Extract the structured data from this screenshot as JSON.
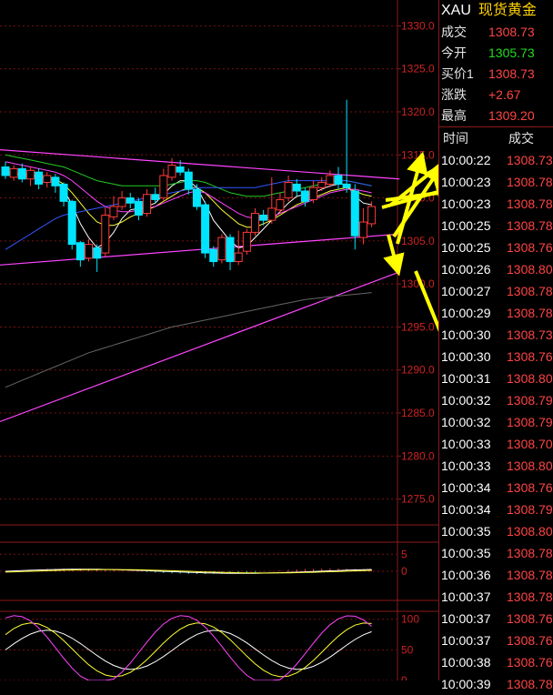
{
  "header": {
    "symbol": "XAU",
    "name": "现货黄金"
  },
  "quote": [
    {
      "label": "成交",
      "value": "1308.73",
      "color": "#ff4444"
    },
    {
      "label": "今开",
      "value": "1305.73",
      "color": "#22dd22"
    },
    {
      "label": "买价1",
      "value": "1308.73",
      "color": "#ff4444"
    },
    {
      "label": "涨跌",
      "value": "+2.67",
      "color": "#ff4444"
    },
    {
      "label": "最高",
      "value": "1309.20",
      "color": "#ff4444"
    }
  ],
  "ticks_header": {
    "time": "时间",
    "price": "成交"
  },
  "ticks": [
    {
      "time": "10:00:22",
      "price": "1308.73"
    },
    {
      "time": "10:00:23",
      "price": "1308.78"
    },
    {
      "time": "10:00:23",
      "price": "1308.78"
    },
    {
      "time": "10:00:25",
      "price": "1308.78"
    },
    {
      "time": "10:00:25",
      "price": "1308.76"
    },
    {
      "time": "10:00:26",
      "price": "1308.80"
    },
    {
      "time": "10:00:27",
      "price": "1308.78"
    },
    {
      "time": "10:00:29",
      "price": "1308.78"
    },
    {
      "time": "10:00:30",
      "price": "1308.73"
    },
    {
      "time": "10:00:30",
      "price": "1308.76"
    },
    {
      "time": "10:00:31",
      "price": "1308.80"
    },
    {
      "time": "10:00:32",
      "price": "1308.79"
    },
    {
      "time": "10:00:32",
      "price": "1308.79"
    },
    {
      "time": "10:00:33",
      "price": "1308.70"
    },
    {
      "time": "10:00:33",
      "price": "1308.80"
    },
    {
      "time": "10:00:34",
      "price": "1308.76"
    },
    {
      "time": "10:00:34",
      "price": "1308.79"
    },
    {
      "time": "10:00:35",
      "price": "1308.80"
    },
    {
      "time": "10:00:35",
      "price": "1308.78"
    },
    {
      "time": "10:00:36",
      "price": "1308.78"
    },
    {
      "time": "10:00:37",
      "price": "1308.78"
    },
    {
      "time": "10:00:37",
      "price": "1308.76"
    },
    {
      "time": "10:00:37",
      "price": "1308.76"
    },
    {
      "time": "10:00:38",
      "price": "1308.76"
    },
    {
      "time": "10:00:39",
      "price": "1308.78"
    }
  ],
  "chart_data": {
    "type": "candlestick",
    "y_ticks": [
      "1330.0",
      "1325.0",
      "1320.0",
      "1315.0",
      "1310.0",
      "1305.0",
      "1300.0",
      "1295.0",
      "1290.0",
      "1285.0",
      "1280.0",
      "1275.0"
    ],
    "ylim": [
      1272,
      1333
    ],
    "grid": true,
    "colors": {
      "up": "#ff3a3a",
      "down": "#00e5ff",
      "grid": "#7a1010",
      "axis_text": "#cc2222"
    },
    "candles": [
      [
        1313.6,
        1312.6,
        1314.2,
        1312.2
      ],
      [
        1312.4,
        1313.4,
        1313.8,
        1312.0
      ],
      [
        1313.4,
        1312.2,
        1314.0,
        1311.8
      ],
      [
        1312.2,
        1313.2,
        1313.6,
        1311.4
      ],
      [
        1313.0,
        1311.6,
        1313.4,
        1311.0
      ],
      [
        1311.8,
        1312.6,
        1313.0,
        1311.2
      ],
      [
        1312.4,
        1311.4,
        1312.8,
        1310.6
      ],
      [
        1311.6,
        1309.6,
        1311.8,
        1309.0
      ],
      [
        1309.6,
        1304.6,
        1309.8,
        1304.0
      ],
      [
        1304.8,
        1302.8,
        1305.0,
        1302.0
      ],
      [
        1303.0,
        1304.6,
        1305.2,
        1302.6
      ],
      [
        1304.2,
        1303.0,
        1304.6,
        1301.4
      ],
      [
        1303.6,
        1308.0,
        1309.0,
        1303.2
      ],
      [
        1307.8,
        1309.0,
        1310.2,
        1307.4
      ],
      [
        1309.0,
        1310.0,
        1310.8,
        1308.6
      ],
      [
        1310.0,
        1309.4,
        1310.6,
        1308.8
      ],
      [
        1309.6,
        1308.0,
        1310.0,
        1307.4
      ],
      [
        1308.2,
        1310.4,
        1311.0,
        1307.8
      ],
      [
        1310.4,
        1309.8,
        1311.2,
        1309.4
      ],
      [
        1310.0,
        1312.6,
        1313.4,
        1309.6
      ],
      [
        1312.4,
        1313.8,
        1314.6,
        1312.0
      ],
      [
        1313.6,
        1313.0,
        1314.4,
        1312.6
      ],
      [
        1313.0,
        1311.0,
        1313.4,
        1310.4
      ],
      [
        1311.0,
        1309.0,
        1311.6,
        1308.6
      ],
      [
        1309.2,
        1303.6,
        1309.6,
        1303.0
      ],
      [
        1304.0,
        1302.6,
        1304.4,
        1302.0
      ],
      [
        1302.8,
        1305.4,
        1305.8,
        1302.4
      ],
      [
        1305.4,
        1302.6,
        1305.8,
        1301.6
      ],
      [
        1302.6,
        1303.6,
        1306.2,
        1302.2
      ],
      [
        1303.8,
        1306.0,
        1306.4,
        1303.4
      ],
      [
        1306.0,
        1308.2,
        1308.8,
        1305.6
      ],
      [
        1308.0,
        1307.4,
        1308.6,
        1306.8
      ],
      [
        1307.4,
        1308.8,
        1312.4,
        1307.0
      ],
      [
        1308.6,
        1309.8,
        1310.6,
        1308.2
      ],
      [
        1310.0,
        1311.8,
        1312.6,
        1309.6
      ],
      [
        1311.6,
        1310.8,
        1312.2,
        1310.2
      ],
      [
        1310.8,
        1309.6,
        1311.2,
        1309.0
      ],
      [
        1309.8,
        1311.2,
        1312.0,
        1309.4
      ],
      [
        1311.2,
        1311.8,
        1312.4,
        1310.8
      ],
      [
        1311.6,
        1312.6,
        1313.2,
        1311.2
      ],
      [
        1312.6,
        1311.6,
        1313.6,
        1311.0
      ],
      [
        1311.6,
        1311.2,
        1321.4,
        1310.6
      ],
      [
        1310.8,
        1305.6,
        1311.6,
        1304.0
      ],
      [
        1305.4,
        1307.2,
        1308.8,
        1304.6
      ],
      [
        1307.0,
        1309.0,
        1309.6,
        1306.6
      ]
    ],
    "ma_series": [
      {
        "color": "#ffffff",
        "values": [
          1312.6,
          1312.8,
          1312.6,
          1312.6,
          1312.4,
          1312.2,
          1312.0,
          1311.0,
          1309.2,
          1307.0,
          1305.4,
          1304.2,
          1304.8,
          1306.0,
          1307.6,
          1308.6,
          1308.8,
          1309.0,
          1309.4,
          1310.4,
          1311.4,
          1312.0,
          1312.0,
          1311.2,
          1309.4,
          1307.4,
          1306.2,
          1305.0,
          1304.2,
          1304.4,
          1305.4,
          1306.4,
          1307.4,
          1308.4,
          1309.4,
          1310.2,
          1310.4,
          1310.6,
          1311.0,
          1311.4,
          1311.6,
          1311.6,
          1310.2,
          1309.4,
          1309.2
        ]
      },
      {
        "color": "#ffff33",
        "values": [
          1313.0,
          1312.9,
          1312.8,
          1312.7,
          1312.6,
          1312.4,
          1312.2,
          1311.6,
          1310.6,
          1309.4,
          1308.2,
          1307.2,
          1306.8,
          1306.8,
          1307.2,
          1307.8,
          1308.2,
          1308.6,
          1309.0,
          1309.6,
          1310.2,
          1310.8,
          1311.2,
          1311.2,
          1310.6,
          1309.6,
          1308.6,
          1307.8,
          1307.0,
          1306.6,
          1306.6,
          1307.0,
          1307.4,
          1308.0,
          1308.6,
          1309.2,
          1309.6,
          1310.0,
          1310.4,
          1310.8,
          1311.0,
          1311.2,
          1310.8,
          1310.4,
          1310.2
        ]
      },
      {
        "color": "#ff44ff",
        "values": [
          1314.2,
          1314.0,
          1313.8,
          1313.6,
          1313.4,
          1313.2,
          1313.0,
          1312.6,
          1312.0,
          1311.2,
          1310.4,
          1309.6,
          1309.0,
          1308.6,
          1308.4,
          1308.4,
          1308.6,
          1308.8,
          1309.0,
          1309.4,
          1309.8,
          1310.2,
          1310.6,
          1310.8,
          1310.6,
          1310.0,
          1309.4,
          1308.8,
          1308.2,
          1307.8,
          1307.6,
          1307.6,
          1307.8,
          1308.2,
          1308.6,
          1309.0,
          1309.4,
          1309.8,
          1310.2,
          1310.6,
          1310.8,
          1311.0,
          1311.0,
          1310.8,
          1310.6
        ]
      },
      {
        "color": "#22cc22",
        "values": [
          1315.0,
          1314.8,
          1314.6,
          1314.4,
          1314.2,
          1314.0,
          1313.8,
          1313.6,
          1313.2,
          1312.8,
          1312.4,
          1312.0,
          1311.8,
          1311.6,
          1311.4,
          1311.4,
          1311.4,
          1311.4,
          1311.4,
          1311.4,
          1311.6,
          1311.8,
          1312.0,
          1312.0,
          1311.8,
          1311.4,
          1311.0,
          1310.6,
          1310.4,
          1310.2,
          1310.2,
          1310.2,
          1310.4,
          1310.6,
          1310.8,
          1311.0,
          1311.2,
          1311.4,
          1311.6,
          1311.8,
          1312.0,
          1312.0,
          1311.8,
          1311.6,
          1311.4
        ]
      },
      {
        "color": "#3355ff",
        "values": [
          1304.0,
          1304.6,
          1305.2,
          1305.8,
          1306.4,
          1307.0,
          1307.6,
          1308.0,
          1308.2,
          1308.4,
          1308.6,
          1308.8,
          1309.0,
          1309.2,
          1309.4,
          1309.6,
          1309.8,
          1310.0,
          1310.2,
          1310.4,
          1310.6,
          1310.8,
          1311.0,
          1311.2,
          1311.2,
          1311.2,
          1311.2,
          1311.2,
          1311.2,
          1311.2,
          1311.2,
          1311.4,
          1311.6,
          1311.8,
          1312.0,
          1312.0,
          1312.0,
          1312.0,
          1312.0,
          1312.0,
          1312.0,
          1312.0,
          1311.8,
          1311.6,
          1311.4
        ]
      },
      {
        "color": "#666666",
        "values": [
          1288.0,
          1288.4,
          1288.8,
          1289.2,
          1289.6,
          1290.0,
          1290.4,
          1290.8,
          1291.2,
          1291.6,
          1292.0,
          1292.3,
          1292.6,
          1292.9,
          1293.2,
          1293.5,
          1293.8,
          1294.1,
          1294.4,
          1294.7,
          1295.0,
          1295.2,
          1295.4,
          1295.6,
          1295.8,
          1296.0,
          1296.2,
          1296.4,
          1296.6,
          1296.8,
          1297.0,
          1297.2,
          1297.4,
          1297.6,
          1297.8,
          1298.0,
          1298.2,
          1298.3,
          1298.4,
          1298.5,
          1298.6,
          1298.7,
          1298.8,
          1298.9,
          1299.0
        ]
      }
    ],
    "trendlines": [
      {
        "color": "#ff44ff",
        "from": [
          0,
          1315.6
        ],
        "to": [
          48,
          1312.2
        ]
      },
      {
        "color": "#ff44ff",
        "from": [
          0,
          1302.2
        ],
        "to": [
          48,
          1305.8
        ]
      },
      {
        "color": "#ff44ff",
        "from": [
          0,
          1284.0
        ],
        "to": [
          48,
          1301.4
        ]
      }
    ],
    "arrows": [
      {
        "color": "#ffff00",
        "from": [
          1318.6,
          1296
        ],
        "to": [
          1329.6,
          1300
        ]
      },
      {
        "color": "#ffff00",
        "from": [
          1309.6,
          1298
        ],
        "to": [
          1316.0,
          1302
        ]
      },
      {
        "color": "#ffff00",
        "from": [
          1310.4,
          1300
        ],
        "to": [
          1314.0,
          1306
        ]
      },
      {
        "color": "#ffff00",
        "from": [
          1304.6,
          1302
        ],
        "to": [
          1314.6,
          1307
        ]
      },
      {
        "color": "#ffff00",
        "from": [
          1305.2,
          1305
        ],
        "to": [
          1311.6,
          1306
        ]
      },
      {
        "color": "#ffff00",
        "from": [
          1329.8,
          1306
        ],
        "to": [
          1328.8,
          1318
        ]
      },
      {
        "color": "#ffff00",
        "from": [
          1313.8,
          1306
        ],
        "to": [
          1321.4,
          1316
        ]
      },
      {
        "color": "#ffff00",
        "from": [
          1298.8,
          1296
        ],
        "to": [
          1284.0,
          1306
        ]
      }
    ],
    "indicator1": {
      "y_ticks": [
        "5",
        "0"
      ],
      "ylim": [
        -8,
        8
      ]
    },
    "indicator2": {
      "y_ticks": [
        "100",
        "50",
        "0"
      ],
      "ylim": [
        0,
        110
      ]
    }
  }
}
